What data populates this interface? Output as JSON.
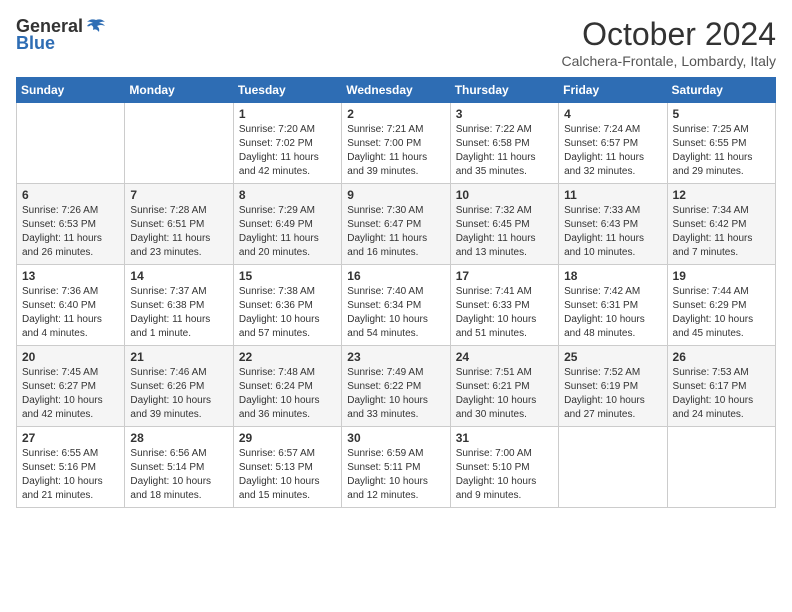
{
  "header": {
    "logo_general": "General",
    "logo_blue": "Blue",
    "month_title": "October 2024",
    "location": "Calchera-Frontale, Lombardy, Italy"
  },
  "weekdays": [
    "Sunday",
    "Monday",
    "Tuesday",
    "Wednesday",
    "Thursday",
    "Friday",
    "Saturday"
  ],
  "weeks": [
    [
      {
        "day": "",
        "detail": ""
      },
      {
        "day": "",
        "detail": ""
      },
      {
        "day": "1",
        "detail": "Sunrise: 7:20 AM\nSunset: 7:02 PM\nDaylight: 11 hours and 42 minutes."
      },
      {
        "day": "2",
        "detail": "Sunrise: 7:21 AM\nSunset: 7:00 PM\nDaylight: 11 hours and 39 minutes."
      },
      {
        "day": "3",
        "detail": "Sunrise: 7:22 AM\nSunset: 6:58 PM\nDaylight: 11 hours and 35 minutes."
      },
      {
        "day": "4",
        "detail": "Sunrise: 7:24 AM\nSunset: 6:57 PM\nDaylight: 11 hours and 32 minutes."
      },
      {
        "day": "5",
        "detail": "Sunrise: 7:25 AM\nSunset: 6:55 PM\nDaylight: 11 hours and 29 minutes."
      }
    ],
    [
      {
        "day": "6",
        "detail": "Sunrise: 7:26 AM\nSunset: 6:53 PM\nDaylight: 11 hours and 26 minutes."
      },
      {
        "day": "7",
        "detail": "Sunrise: 7:28 AM\nSunset: 6:51 PM\nDaylight: 11 hours and 23 minutes."
      },
      {
        "day": "8",
        "detail": "Sunrise: 7:29 AM\nSunset: 6:49 PM\nDaylight: 11 hours and 20 minutes."
      },
      {
        "day": "9",
        "detail": "Sunrise: 7:30 AM\nSunset: 6:47 PM\nDaylight: 11 hours and 16 minutes."
      },
      {
        "day": "10",
        "detail": "Sunrise: 7:32 AM\nSunset: 6:45 PM\nDaylight: 11 hours and 13 minutes."
      },
      {
        "day": "11",
        "detail": "Sunrise: 7:33 AM\nSunset: 6:43 PM\nDaylight: 11 hours and 10 minutes."
      },
      {
        "day": "12",
        "detail": "Sunrise: 7:34 AM\nSunset: 6:42 PM\nDaylight: 11 hours and 7 minutes."
      }
    ],
    [
      {
        "day": "13",
        "detail": "Sunrise: 7:36 AM\nSunset: 6:40 PM\nDaylight: 11 hours and 4 minutes."
      },
      {
        "day": "14",
        "detail": "Sunrise: 7:37 AM\nSunset: 6:38 PM\nDaylight: 11 hours and 1 minute."
      },
      {
        "day": "15",
        "detail": "Sunrise: 7:38 AM\nSunset: 6:36 PM\nDaylight: 10 hours and 57 minutes."
      },
      {
        "day": "16",
        "detail": "Sunrise: 7:40 AM\nSunset: 6:34 PM\nDaylight: 10 hours and 54 minutes."
      },
      {
        "day": "17",
        "detail": "Sunrise: 7:41 AM\nSunset: 6:33 PM\nDaylight: 10 hours and 51 minutes."
      },
      {
        "day": "18",
        "detail": "Sunrise: 7:42 AM\nSunset: 6:31 PM\nDaylight: 10 hours and 48 minutes."
      },
      {
        "day": "19",
        "detail": "Sunrise: 7:44 AM\nSunset: 6:29 PM\nDaylight: 10 hours and 45 minutes."
      }
    ],
    [
      {
        "day": "20",
        "detail": "Sunrise: 7:45 AM\nSunset: 6:27 PM\nDaylight: 10 hours and 42 minutes."
      },
      {
        "day": "21",
        "detail": "Sunrise: 7:46 AM\nSunset: 6:26 PM\nDaylight: 10 hours and 39 minutes."
      },
      {
        "day": "22",
        "detail": "Sunrise: 7:48 AM\nSunset: 6:24 PM\nDaylight: 10 hours and 36 minutes."
      },
      {
        "day": "23",
        "detail": "Sunrise: 7:49 AM\nSunset: 6:22 PM\nDaylight: 10 hours and 33 minutes."
      },
      {
        "day": "24",
        "detail": "Sunrise: 7:51 AM\nSunset: 6:21 PM\nDaylight: 10 hours and 30 minutes."
      },
      {
        "day": "25",
        "detail": "Sunrise: 7:52 AM\nSunset: 6:19 PM\nDaylight: 10 hours and 27 minutes."
      },
      {
        "day": "26",
        "detail": "Sunrise: 7:53 AM\nSunset: 6:17 PM\nDaylight: 10 hours and 24 minutes."
      }
    ],
    [
      {
        "day": "27",
        "detail": "Sunrise: 6:55 AM\nSunset: 5:16 PM\nDaylight: 10 hours and 21 minutes."
      },
      {
        "day": "28",
        "detail": "Sunrise: 6:56 AM\nSunset: 5:14 PM\nDaylight: 10 hours and 18 minutes."
      },
      {
        "day": "29",
        "detail": "Sunrise: 6:57 AM\nSunset: 5:13 PM\nDaylight: 10 hours and 15 minutes."
      },
      {
        "day": "30",
        "detail": "Sunrise: 6:59 AM\nSunset: 5:11 PM\nDaylight: 10 hours and 12 minutes."
      },
      {
        "day": "31",
        "detail": "Sunrise: 7:00 AM\nSunset: 5:10 PM\nDaylight: 10 hours and 9 minutes."
      },
      {
        "day": "",
        "detail": ""
      },
      {
        "day": "",
        "detail": ""
      }
    ]
  ]
}
